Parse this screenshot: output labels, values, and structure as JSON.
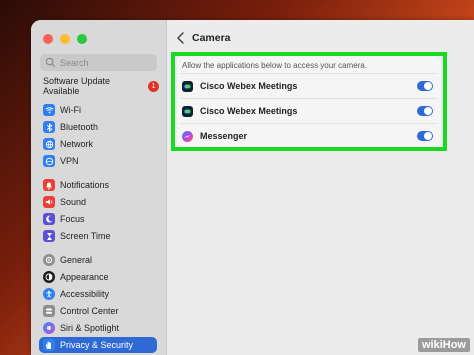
{
  "sidebar": {
    "search_placeholder": "Search",
    "update": {
      "label": "Software Update Available",
      "count": "1"
    },
    "items": [
      {
        "label": "Wi-Fi",
        "icon": "wifi-icon",
        "color": "#2f7ff0"
      },
      {
        "label": "Bluetooth",
        "icon": "bluetooth-icon",
        "color": "#2f7ff0"
      },
      {
        "label": "Network",
        "icon": "network-icon",
        "color": "#2f7ff0"
      },
      {
        "label": "VPN",
        "icon": "vpn-icon",
        "color": "#2f7ff0"
      },
      {
        "label": "Notifications",
        "icon": "bell-icon",
        "color": "#ea4038"
      },
      {
        "label": "Sound",
        "icon": "speaker-icon",
        "color": "#ea4038"
      },
      {
        "label": "Focus",
        "icon": "moon-icon",
        "color": "#5b50d6"
      },
      {
        "label": "Screen Time",
        "icon": "hourglass-icon",
        "color": "#5b50d6"
      },
      {
        "label": "General",
        "icon": "gear-icon",
        "color": "#8e8e93"
      },
      {
        "label": "Appearance",
        "icon": "appearance-icon",
        "color": "#1c1c1e"
      },
      {
        "label": "Accessibility",
        "icon": "accessibility-icon",
        "color": "#2f7ff0"
      },
      {
        "label": "Control Center",
        "icon": "control-center-icon",
        "color": "#8e8e93"
      },
      {
        "label": "Siri & Spotlight",
        "icon": "siri-icon",
        "color": "#9b4fd8"
      },
      {
        "label": "Privacy & Security",
        "icon": "hand-icon",
        "color": "#2f7ff0"
      }
    ],
    "active_item": "Privacy & Security"
  },
  "main": {
    "title": "Camera",
    "description": "Allow the applications below to access your camera.",
    "apps": [
      {
        "name": "Cisco Webex Meetings",
        "icon": "webex-icon",
        "enabled": true
      },
      {
        "name": "Cisco Webex Meetings",
        "icon": "webex-icon",
        "enabled": true
      },
      {
        "name": "Messenger",
        "icon": "messenger-icon",
        "enabled": true
      }
    ],
    "highlight_color": "#19d922"
  },
  "watermark": "wikiHow"
}
